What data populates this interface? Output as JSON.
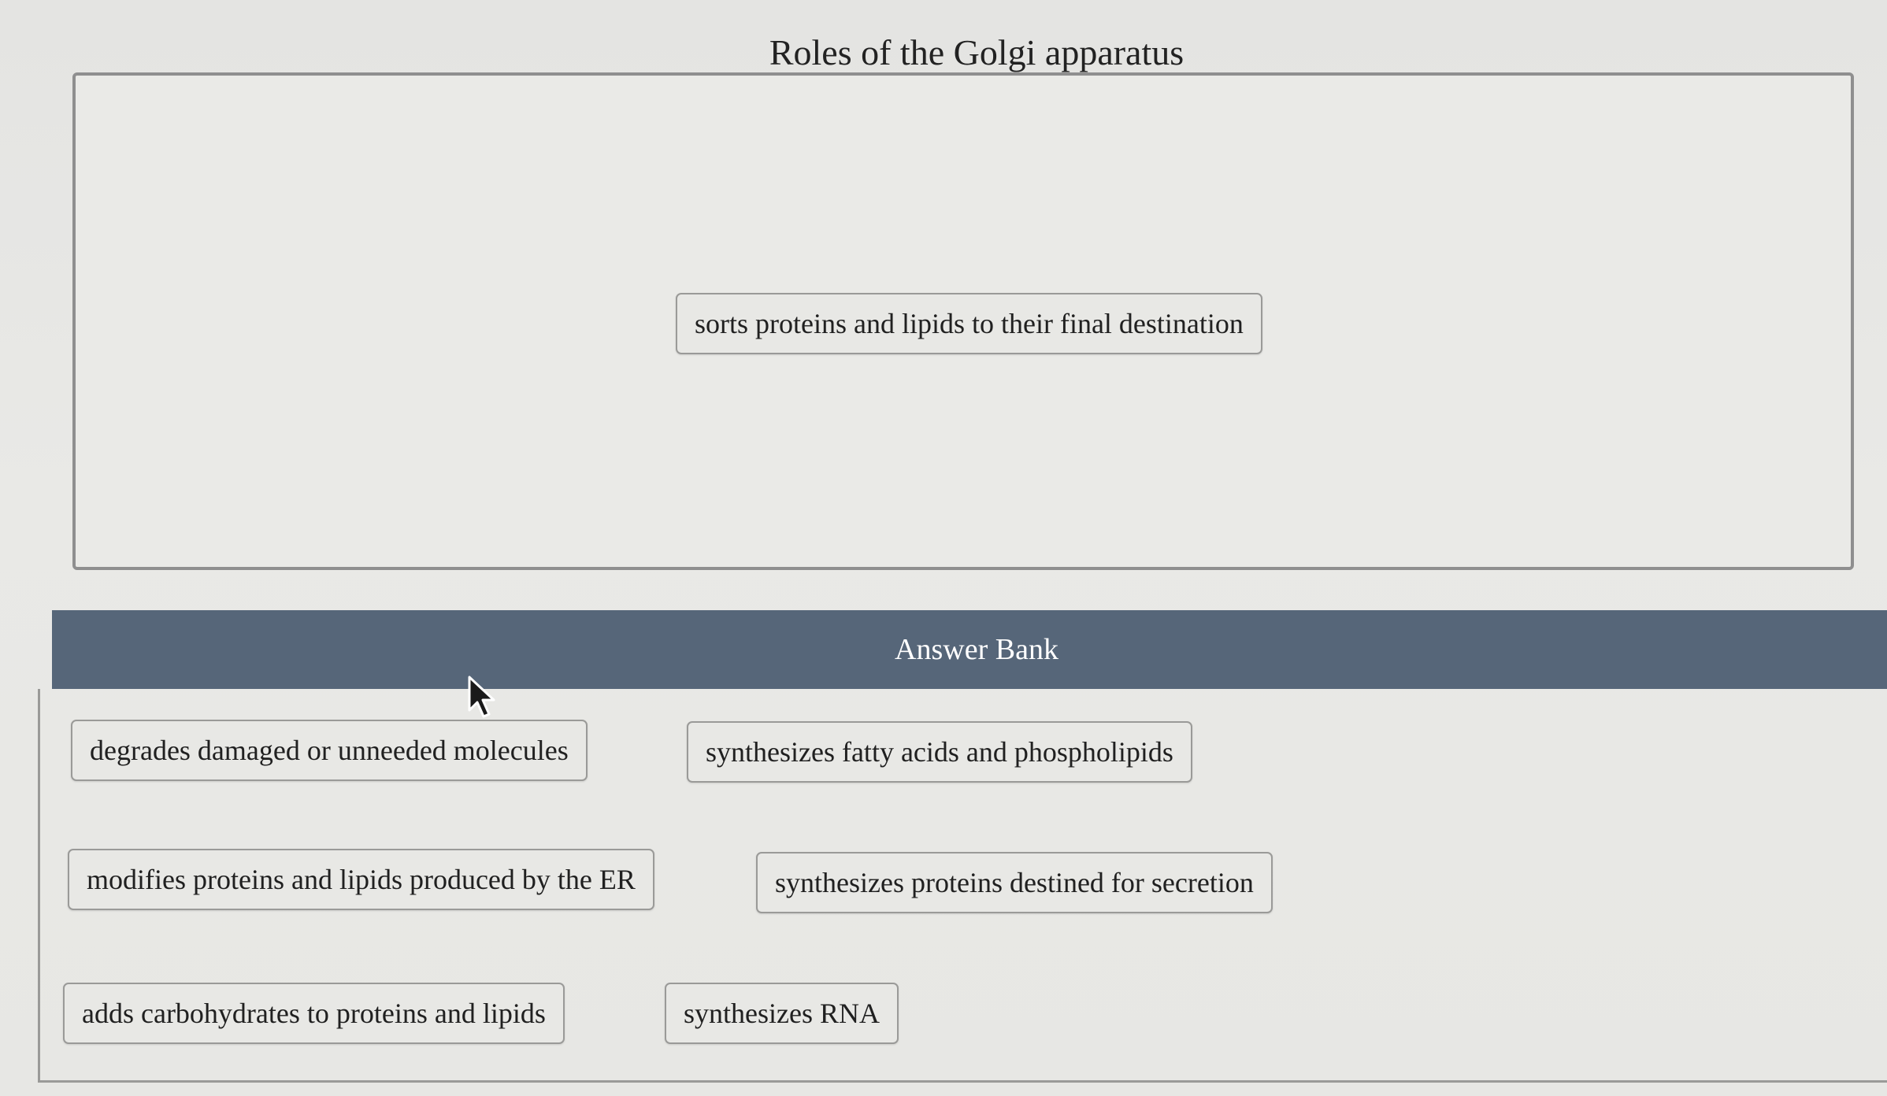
{
  "question": {
    "title": "Roles of the Golgi apparatus"
  },
  "target": {
    "placed_items": [
      "sorts proteins and lipids to their final destination"
    ]
  },
  "answer_bank": {
    "header": "Answer Bank",
    "items": [
      "degrades damaged or unneeded molecules",
      "synthesizes fatty acids and phospholipids",
      "modifies proteins and lipids produced by the ER",
      "synthesizes proteins destined for secretion",
      "adds carbohydrates to proteins and lipids",
      "synthesizes RNA"
    ]
  },
  "colors": {
    "bank_header": "#566679",
    "chip_border": "#9a9a98",
    "background": "#e6e6e4"
  },
  "icons": {
    "cursor": "mouse-pointer-icon"
  }
}
